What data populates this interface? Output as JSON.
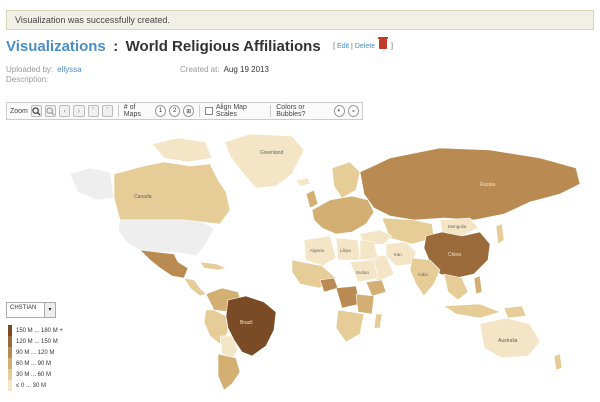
{
  "notice": {
    "text": "Visualization was successfully created."
  },
  "header": {
    "section": "Visualizations",
    "separator": ":",
    "title": "World Religious Affiliations",
    "edit": "Edit",
    "pipe": "|",
    "delete": "Delete",
    "bracket_open": "[",
    "bracket_close": "]"
  },
  "meta": {
    "uploaded_label": "Uploaded by:",
    "uploaded_by": "ellyssa",
    "created_label": "Created at:",
    "created_at": "Aug 19 2013",
    "description_label": "Description:"
  },
  "toolbar": {
    "zoom_label": "Zoom",
    "maps_label": "# of Maps",
    "maps_1": "1",
    "maps_2": "2",
    "align_label": "Align Map Scales",
    "colors_label": "Colors or Bubbles?"
  },
  "map": {
    "labels": {
      "greenland": "Greenland",
      "canada": "Canada",
      "russia": "Russia",
      "china": "China",
      "mongolia": "Mongolia",
      "brazil": "Brazil",
      "australia": "Australia",
      "algeria": "Algeria",
      "libya": "Libya",
      "sudan": "Sudan",
      "iran": "Iran",
      "india": "India"
    },
    "colors": {
      "c0": "#f3e5c5",
      "c1": "#e6cc96",
      "c2": "#d4af73",
      "c3": "#b98a51",
      "c4": "#9a6a3a",
      "c5": "#7a4b24",
      "nodata": "#eeeeee",
      "stroke": "#ffffff"
    },
    "levels": {
      "greenland": "≤ 0 ... 30 M",
      "canada": "≤ 0 ... 30 M",
      "usa": "no data",
      "mexico": "90 M ... 120 M",
      "brazil": "150 M ... 180 M +",
      "russia": "90 M ... 120 M",
      "china": "60 M ... 90 M",
      "mongolia": "≤ 0 ... 30 M",
      "india": "≤ 0 ... 30 M",
      "australia": "≤ 0 ... 30 M"
    }
  },
  "legend": {
    "selected": "CHSTIAN",
    "dropdown_icon": "chevron-down-icon",
    "items": [
      {
        "label": "150 M ... 180 M +",
        "color": "#7a4b24"
      },
      {
        "label": "120 M ... 150 M",
        "color": "#9a6a3a"
      },
      {
        "label": "90 M ... 120 M",
        "color": "#b98a51"
      },
      {
        "label": "60 M ... 90 M",
        "color": "#d4af73"
      },
      {
        "label": "30 M ... 60 M",
        "color": "#e6cc96"
      },
      {
        "label": "≤ 0 ... 30 M",
        "color": "#f3e5c5"
      }
    ]
  }
}
